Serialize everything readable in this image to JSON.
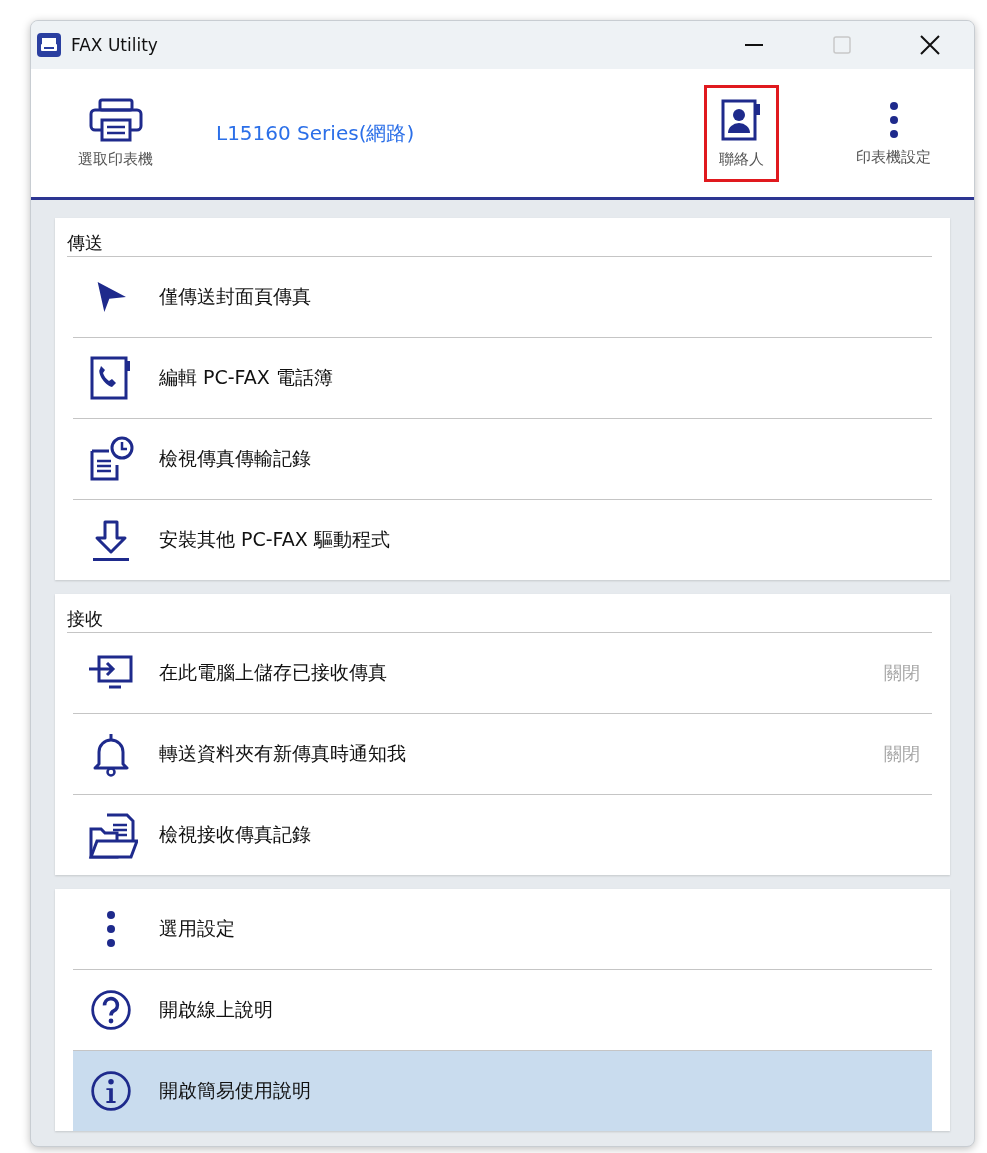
{
  "window": {
    "title": "FAX Utility"
  },
  "header": {
    "printer_button": {
      "label": "選取印表機"
    },
    "printer_name": "L15160 Series(網路)",
    "actions": [
      {
        "kind": "contacts",
        "label": "聯絡人",
        "highlighted": true
      },
      {
        "kind": "more",
        "label": "印表機設定",
        "highlighted": false
      }
    ]
  },
  "sections": [
    {
      "title": "傳送",
      "items": [
        {
          "kind": "send",
          "label": "僅傳送封面頁傳真",
          "selected": false
        },
        {
          "kind": "phonebook",
          "label": "編輯 PC-FAX 電話簿",
          "selected": false
        },
        {
          "kind": "log",
          "label": "檢視傳真傳輸記錄",
          "selected": false
        },
        {
          "kind": "download",
          "label": "安裝其他 PC-FAX 驅動程式",
          "selected": false
        }
      ]
    },
    {
      "title": "接收",
      "items": [
        {
          "kind": "monitor",
          "label": "在此電腦上儲存已接收傳真",
          "status": "關閉",
          "selected": false
        },
        {
          "kind": "bell",
          "label": "轉送資料夾有新傳真時通知我",
          "status": "關閉",
          "selected": false
        },
        {
          "kind": "folder",
          "label": "檢視接收傳真記錄",
          "selected": false
        }
      ]
    },
    {
      "items": [
        {
          "kind": "more",
          "label": "選用設定",
          "selected": false
        },
        {
          "kind": "help",
          "label": "開啟線上說明",
          "selected": false
        },
        {
          "kind": "info",
          "label": "開啟簡易使用說明",
          "selected": true
        }
      ]
    }
  ]
}
